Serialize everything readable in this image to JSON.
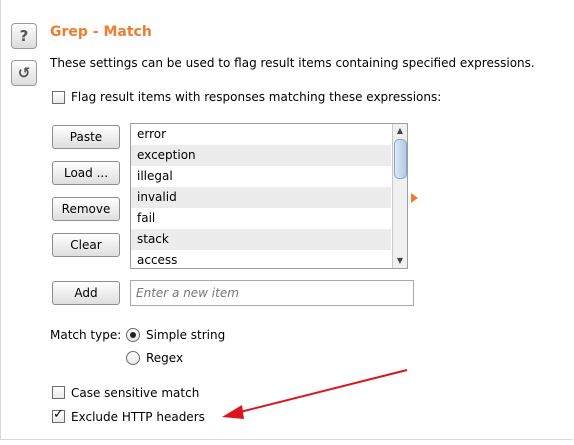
{
  "panel": {
    "title": "Grep - Match",
    "description": "These settings can be used to flag result items containing specified expressions.",
    "help_icon": "?",
    "reset_icon": "↺"
  },
  "flag_checkbox": {
    "label": "Flag result items with responses matching these expressions:",
    "checked": false
  },
  "buttons": {
    "paste": "Paste",
    "load": "Load ...",
    "remove": "Remove",
    "clear": "Clear",
    "add": "Add"
  },
  "expressions": [
    "error",
    "exception",
    "illegal",
    "invalid",
    "fail",
    "stack",
    "access"
  ],
  "new_item": {
    "placeholder": "Enter a new item",
    "value": ""
  },
  "match_type": {
    "label": "Match type:",
    "options": [
      {
        "label": "Simple string",
        "selected": true
      },
      {
        "label": "Regex",
        "selected": false
      }
    ]
  },
  "case_sensitive": {
    "label": "Case sensitive match",
    "checked": false
  },
  "exclude_headers": {
    "label": "Exclude HTTP headers",
    "checked": true
  },
  "colors": {
    "accent": "#ef7c2f",
    "annotation_arrow": "#d9161c"
  },
  "icons": {
    "help": "help-icon",
    "reset": "reset-icon",
    "expand": "expand-arrow-icon",
    "checkmark": "checkmark-icon"
  }
}
